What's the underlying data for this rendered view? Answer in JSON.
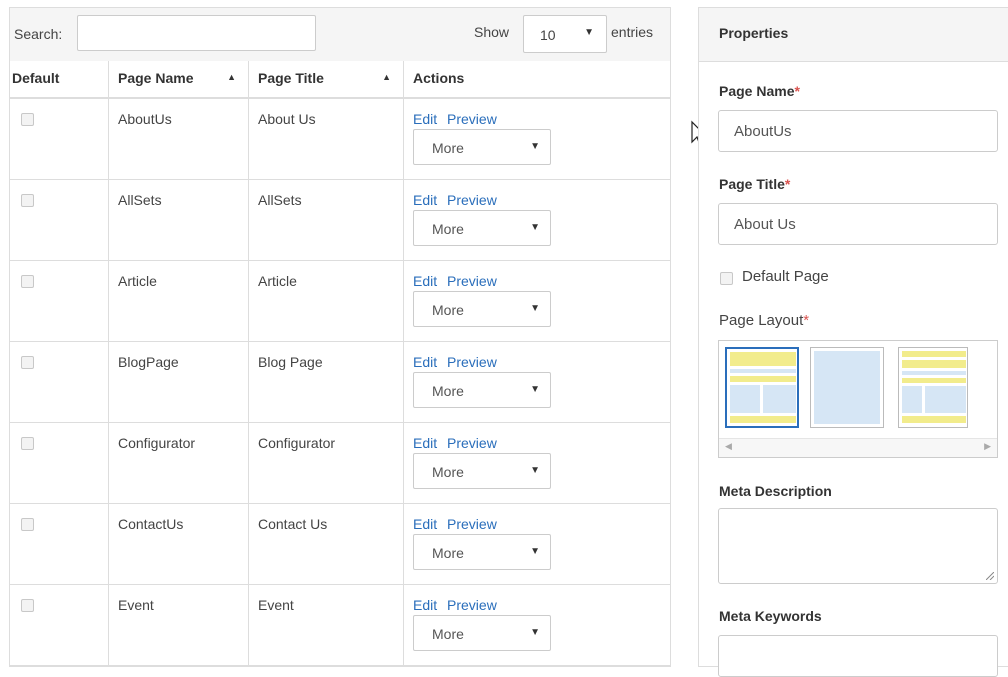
{
  "toolbar": {
    "search_label": "Search:",
    "search_value": "",
    "show_label": "Show",
    "entries_value": "10",
    "entries_label": "entries"
  },
  "table": {
    "headers": [
      "Default",
      "Page Name",
      "Page Title",
      "Actions"
    ],
    "rows": [
      {
        "page_name": "AboutUs",
        "page_title": "About Us",
        "default": false
      },
      {
        "page_name": "AllSets",
        "page_title": "AllSets",
        "default": false
      },
      {
        "page_name": "Article",
        "page_title": "Article",
        "default": false
      },
      {
        "page_name": "BlogPage",
        "page_title": "Blog Page",
        "default": false
      },
      {
        "page_name": "Configurator",
        "page_title": "Configurator",
        "default": false
      },
      {
        "page_name": "ContactUs",
        "page_title": "Contact Us",
        "default": false
      },
      {
        "page_name": "Event",
        "page_title": "Event",
        "default": false
      }
    ],
    "edit_label": "Edit",
    "preview_label": "Preview",
    "more_label": "More"
  },
  "properties": {
    "title": "Properties",
    "page_name_label": "Page Name",
    "page_name_value": "AboutUs",
    "page_title_label": "Page Title",
    "page_title_value": "About Us",
    "default_page_label": "Default Page",
    "page_layout_label": "Page Layout",
    "meta_description_label": "Meta Description",
    "meta_keywords_label": "Meta Keywords",
    "required_mark": "*"
  },
  "colors": {
    "link": "#2a6ebb",
    "required": "#d9534f",
    "layout_yellow": "#f2ec8c",
    "layout_blue": "#d6e6f5",
    "selected_border": "#2a6ebb"
  }
}
